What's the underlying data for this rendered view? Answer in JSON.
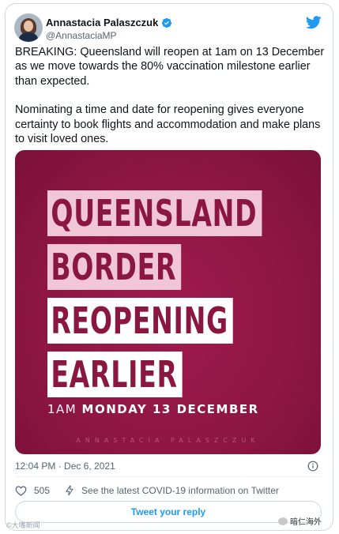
{
  "user": {
    "display_name": "Annastacia Palaszczuk",
    "handle": "@AnnastaciaMP",
    "verified_icon": "verified-badge-icon",
    "avatar_icon": "profile-photo"
  },
  "brand_icon": "twitter-bird-icon",
  "tweet": {
    "paragraph_1": "BREAKING: Queensland will reopen at 1am on 13 December as we move towards the 80% vaccination milestone earlier than expected.",
    "paragraph_2": "Nominating a time and date for reopening gives everyone certainty to book flights and accommodation and make plans to visit loved ones."
  },
  "media": {
    "headline_1": "QUEENSLAND",
    "headline_2": "BORDER",
    "headline_3": "REOPENING",
    "headline_4": "EARLIER",
    "date_prefix": "1AM",
    "date_main": "MONDAY 13 DECEMBER",
    "signature": "ANNASTACIA PALASZCZUK",
    "background_color": "#8f1643",
    "highlight_color": "#ffffff",
    "pale_highlight_color": "#f1c7d7"
  },
  "meta": {
    "timestamp": "12:04 PM · Dec 6, 2021"
  },
  "actions": {
    "like_count": "505",
    "covid_link": "See the latest COVID-19 information on Twitter"
  },
  "reply_button": {
    "label": "Tweet your reply"
  },
  "overlay": {
    "watermark_left": "©大嘴新闻",
    "watermark_right": "暗仁海外"
  },
  "colors": {
    "accent": "#1d9bf0",
    "secondary_text": "#536471",
    "border": "#cfd9de"
  }
}
